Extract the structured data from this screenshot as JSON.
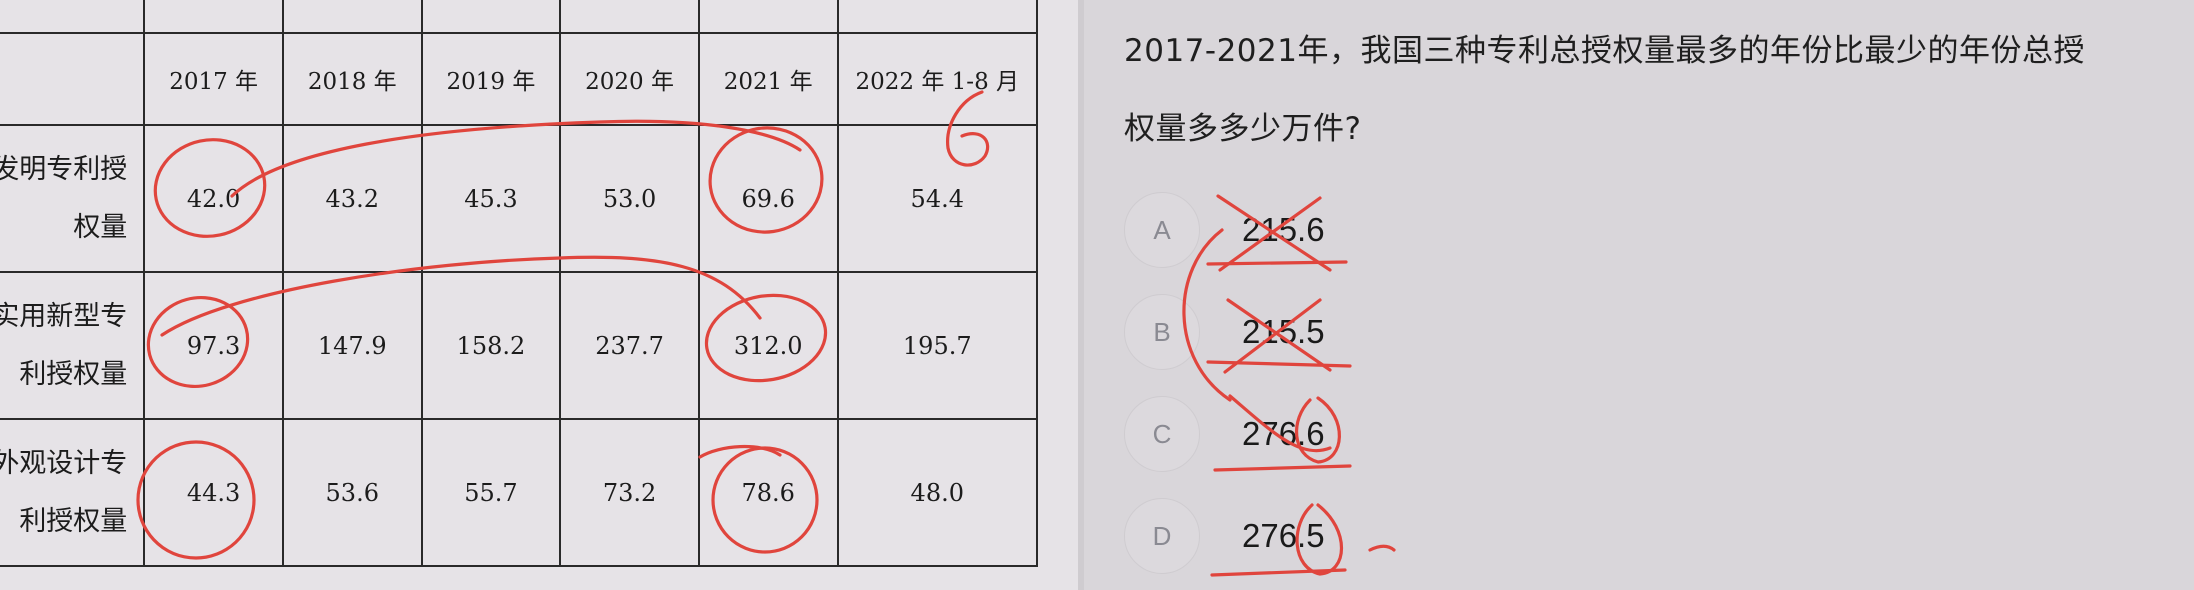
{
  "table": {
    "columns": [
      "2017 年",
      "2018 年",
      "2019 年",
      "2020 年",
      "2021 年",
      "2022 年 1-8 月"
    ],
    "rows": [
      {
        "label_line1": "发明专利授",
        "label_line2": "权量",
        "values": [
          "42.0",
          "43.2",
          "45.3",
          "53.0",
          "69.6",
          "54.4"
        ]
      },
      {
        "label_line1": "实用新型专",
        "label_line2": "利授权量",
        "values": [
          "97.3",
          "147.9",
          "158.2",
          "237.7",
          "312.0",
          "195.7"
        ]
      },
      {
        "label_line1": "外观设计专",
        "label_line2": "利授权量",
        "values": [
          "44.3",
          "53.6",
          "55.7",
          "73.2",
          "78.6",
          "48.0"
        ]
      }
    ]
  },
  "question": {
    "line1": "2017-2021年，我国三种专利总授权量最多的年份比最少的年份总授",
    "line2": "权量多多少万件?"
  },
  "options": [
    {
      "letter": "A",
      "value": "215.6"
    },
    {
      "letter": "B",
      "value": "215.5"
    },
    {
      "letter": "C",
      "value": "276.6"
    },
    {
      "letter": "D",
      "value": "276.5"
    }
  ],
  "annotations": {
    "ink_color": "#e0453d",
    "handwritten_digit": "6"
  }
}
